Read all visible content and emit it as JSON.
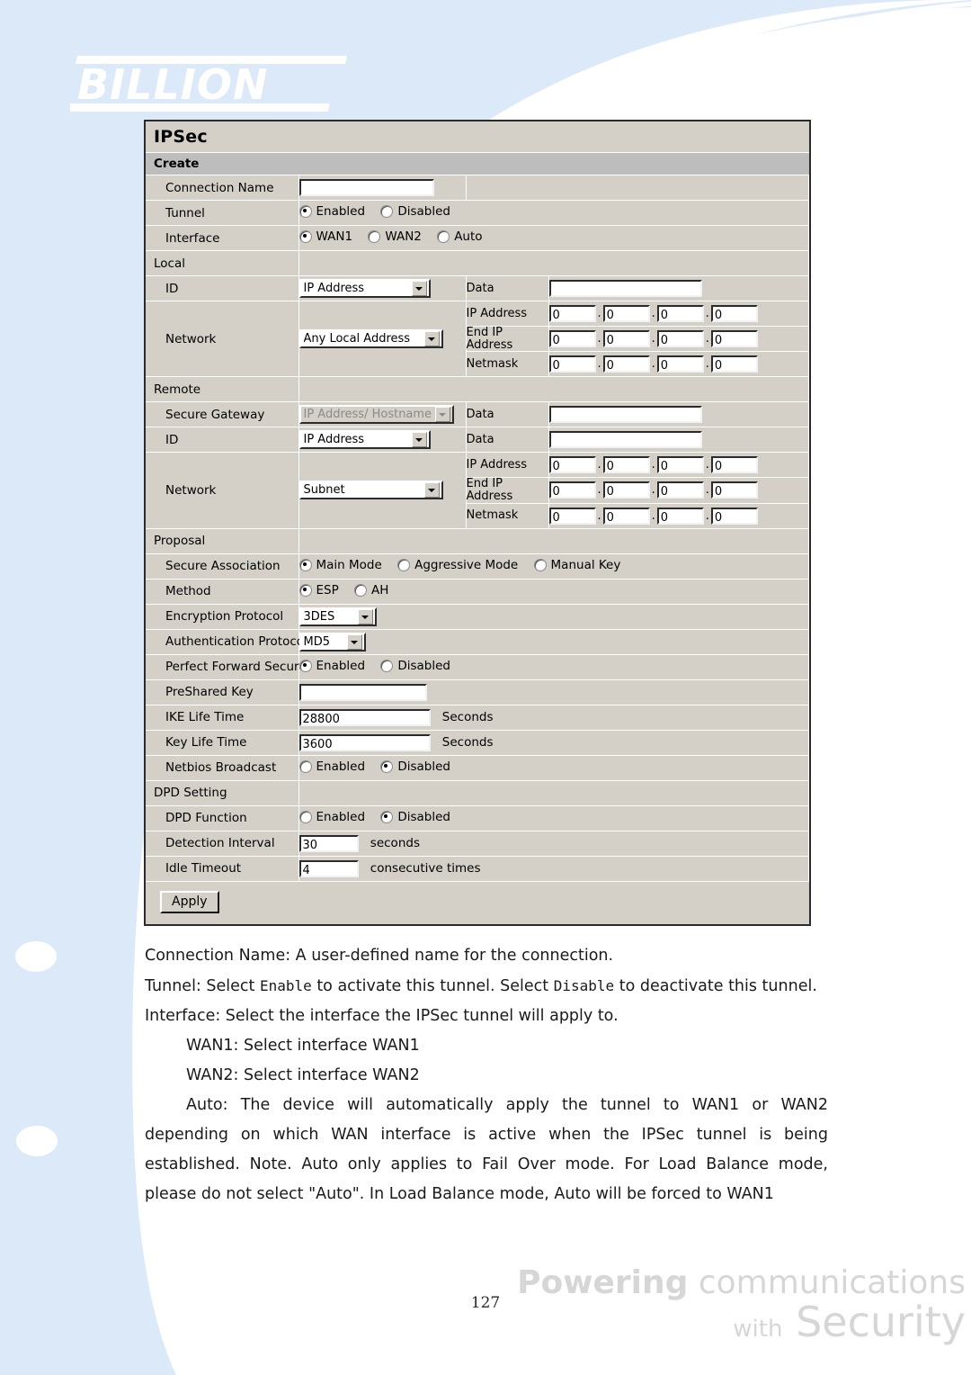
{
  "brand": {
    "logo_text": "BILLION",
    "tagline_line1_bold": "Powering",
    "tagline_line1_rest": "communications",
    "tagline_line2_small": "with",
    "tagline_line2_big": "Security",
    "page_number": "127",
    "accent_blue": "#dce9f9",
    "label_khaki": "#d9d9ad",
    "panel_gray": "#d4d0c8"
  },
  "panel": {
    "title": "IPSec",
    "section": "Create",
    "apply_label": "Apply",
    "rows": {
      "connection_name": {
        "label": "Connection Name",
        "value": ""
      },
      "tunnel": {
        "label": "Tunnel",
        "options": [
          "Enabled",
          "Disabled"
        ],
        "selected": "Enabled"
      },
      "interface": {
        "label": "Interface",
        "options": [
          "WAN1",
          "WAN2",
          "Auto"
        ],
        "selected": "WAN1"
      },
      "local_header": {
        "label": "Local"
      },
      "local_id": {
        "label": "ID",
        "select_value": "IP Address",
        "data_label": "Data",
        "data_value": ""
      },
      "local_network": {
        "label": "Network",
        "select_value": "Any Local Address",
        "ip_label": "IP Address",
        "ip_octets": [
          "0",
          "0",
          "0",
          "0"
        ],
        "endip_label": "End IP Address",
        "endip_octets": [
          "0",
          "0",
          "0",
          "0"
        ],
        "netmask_label": "Netmask",
        "netmask_octets": [
          "0",
          "0",
          "0",
          "0"
        ]
      },
      "remote_header": {
        "label": "Remote"
      },
      "secure_gateway": {
        "label": "Secure Gateway",
        "select_value": "IP Address/ Hostname",
        "disabled": true,
        "data_label": "Data",
        "data_value": ""
      },
      "remote_id": {
        "label": "ID",
        "select_value": "IP Address",
        "data_label": "Data",
        "data_value": ""
      },
      "remote_network": {
        "label": "Network",
        "select_value": "Subnet",
        "ip_label": "IP Address",
        "ip_octets": [
          "0",
          "0",
          "0",
          "0"
        ],
        "endip_label": "End IP Address",
        "endip_octets": [
          "0",
          "0",
          "0",
          "0"
        ],
        "netmask_label": "Netmask",
        "netmask_octets": [
          "0",
          "0",
          "0",
          "0"
        ]
      },
      "proposal_header": {
        "label": "Proposal"
      },
      "secure_association": {
        "label": "Secure Association",
        "options": [
          "Main Mode",
          "Aggressive Mode",
          "Manual Key"
        ],
        "selected": "Main Mode"
      },
      "method": {
        "label": "Method",
        "options": [
          "ESP",
          "AH"
        ],
        "selected": "ESP"
      },
      "encryption_protocol": {
        "label": "Encryption Protocol",
        "select_value": "3DES"
      },
      "authentication_protocol": {
        "label": "Authentication Protocol",
        "select_value": "MD5"
      },
      "perfect_forward_secure": {
        "label": "Perfect Forward Secure",
        "options": [
          "Enabled",
          "Disabled"
        ],
        "selected": "Enabled"
      },
      "preshared_key": {
        "label": "PreShared Key",
        "value": ""
      },
      "ike_life_time": {
        "label": "IKE Life Time",
        "value": "28800",
        "unit": "Seconds"
      },
      "key_life_time": {
        "label": "Key Life Time",
        "value": "3600",
        "unit": "Seconds"
      },
      "netbios_broadcast": {
        "label": "Netbios Broadcast",
        "options": [
          "Enabled",
          "Disabled"
        ],
        "selected": "Disabled"
      },
      "dpd_header": {
        "label": "DPD Setting"
      },
      "dpd_function": {
        "label": "DPD Function",
        "options": [
          "Enabled",
          "Disabled"
        ],
        "selected": "Disabled"
      },
      "detection_interval": {
        "label": "Detection Interval",
        "value": "30",
        "unit": "seconds"
      },
      "idle_timeout": {
        "label": "Idle Timeout",
        "value": "4",
        "unit": "consecutive times"
      }
    }
  },
  "prose": {
    "p1": "Connection Name: A user-defined name for the connection.",
    "p2_a": "Tunnel: Select ",
    "p2_code1": "Enable",
    "p2_b": " to activate this tunnel. Select ",
    "p2_code2": "Disable",
    "p2_c": " to deactivate this tunnel.",
    "p3": "Interface: Select the interface the IPSec tunnel will apply to.",
    "p4": "WAN1: Select interface WAN1",
    "p5": "WAN2: Select interface WAN2",
    "p6": "Auto: The device will automatically apply the tunnel to WAN1 or WAN2 depending on which WAN interface is active when the IPSec tunnel is being established. Note. Auto only applies to Fail Over mode. For Load Balance mode, please do not select \"Auto\". In Load Balance mode, Auto will be forced to WAN1"
  }
}
